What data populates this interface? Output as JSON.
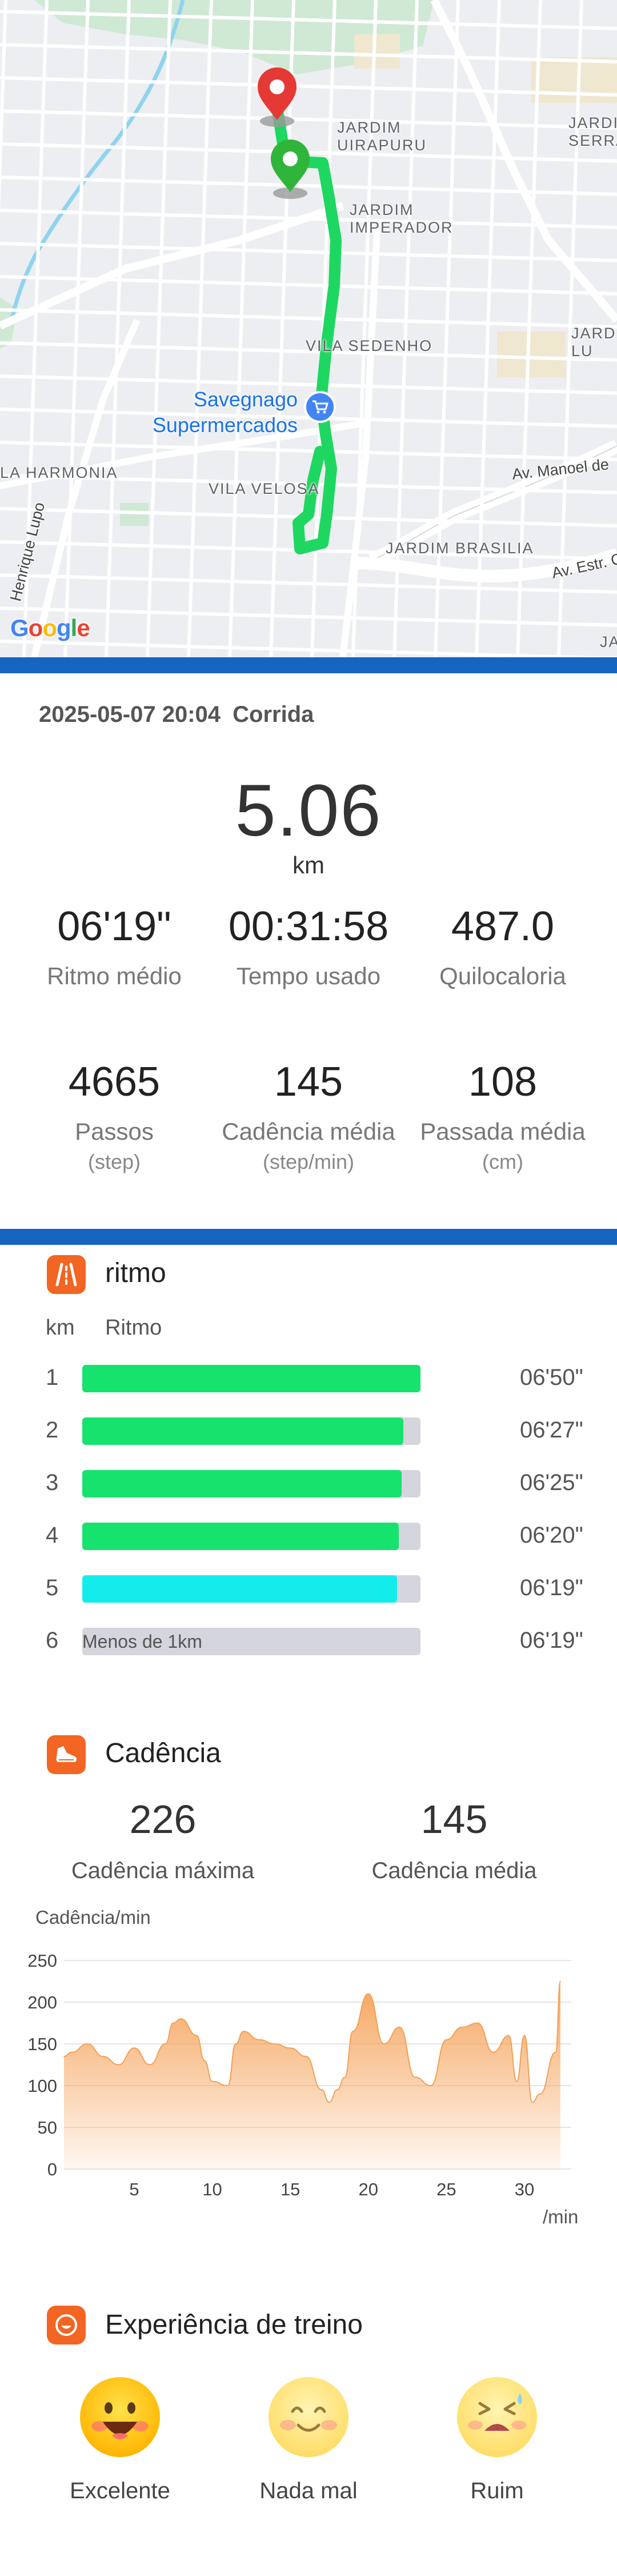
{
  "map": {
    "labels": {
      "jardim_uirapuru": "JARDIM\nUIRAPURU",
      "jardim_serra": "JARDI\nSERRA A",
      "jardim_imperador": "JARDIM\nIMPERADOR",
      "vila_sedenho": "VILA SEDENHO",
      "jard_lu": "JARD\nLU",
      "la_harmonia": "LA HARMONIA",
      "vila_velosa": "VILA VELOSA",
      "jardim_brasilia": "JARDIM BRASILIA",
      "ja": "JA"
    },
    "poi": "Savegnago\nSupermercados",
    "streets": {
      "av_manoel": "Av. Manoel de",
      "av_estr": "Av. Estr. C",
      "henrique_lupo": "Henrique Lupo"
    },
    "logo": "Google",
    "logo_colors": [
      "#4285f4",
      "#ea4335",
      "#fbbc05",
      "#4285f4",
      "#34a853",
      "#ea4335"
    ],
    "route_color": "#1ed760",
    "start_color": "#2fb53a",
    "end_color": "#e53935"
  },
  "activity": {
    "datetime": "2025-05-07 20:04",
    "type": "Corrida",
    "distance": "5.06",
    "distance_unit": "km"
  },
  "stats_row1": [
    {
      "value": "06'19\"",
      "label": "Ritmo médio"
    },
    {
      "value": "00:31:58",
      "label": "Tempo usado"
    },
    {
      "value": "487.0",
      "label": "Quilocaloria"
    }
  ],
  "stats_row2": [
    {
      "value": "4665",
      "label": "Passos",
      "unit": "(step)"
    },
    {
      "value": "145",
      "label": "Cadência média",
      "unit": "(step/min)"
    },
    {
      "value": "108",
      "label": "Passada média",
      "unit": "(cm)"
    }
  ],
  "pace": {
    "title": "ritmo",
    "col_km": "km",
    "col_pace": "Ritmo",
    "colors": {
      "fill": "#16e26e",
      "best": "#14ecec",
      "track": "#d5d5de"
    },
    "rows": [
      {
        "km": "1",
        "fraction": 1.0,
        "time": "06'50\"",
        "best": false,
        "note": ""
      },
      {
        "km": "2",
        "fraction": 0.95,
        "time": "06'27\"",
        "best": false,
        "note": ""
      },
      {
        "km": "3",
        "fraction": 0.945,
        "time": "06'25\"",
        "best": false,
        "note": ""
      },
      {
        "km": "4",
        "fraction": 0.935,
        "time": "06'20\"",
        "best": false,
        "note": ""
      },
      {
        "km": "5",
        "fraction": 0.93,
        "time": "06'19\"",
        "best": true,
        "note": ""
      },
      {
        "km": "6",
        "fraction": 0,
        "time": "06'19\"",
        "best": false,
        "note": "Menos de 1km"
      }
    ]
  },
  "cadence": {
    "title": "Cadência",
    "max_value": "226",
    "max_label": "Cadência máxima",
    "avg_value": "145",
    "avg_label": "Cadência média",
    "y_axis_label": "Cadência/min",
    "x_unit": "/min"
  },
  "chart_data": {
    "type": "area",
    "ylabel": "Cadência/min",
    "xlabel": "/min",
    "ylim": [
      0,
      250
    ],
    "xlim": [
      0.5,
      33
    ],
    "yticks": [
      0,
      50,
      100,
      150,
      200,
      250
    ],
    "xticks": [
      5,
      10,
      15,
      20,
      25,
      30
    ],
    "grid": true,
    "color": "#f5a055",
    "x": [
      0.5,
      1,
      2,
      3,
      4,
      5,
      6,
      7,
      7.5,
      8,
      9,
      9.5,
      10,
      11,
      11.5,
      12,
      13,
      14,
      15,
      16,
      17,
      17.5,
      18,
      18.5,
      19,
      20,
      21,
      22,
      23,
      24,
      25,
      26,
      27,
      28,
      29,
      29.5,
      30,
      30.5,
      31,
      32,
      32.3
    ],
    "values": [
      135,
      140,
      150,
      135,
      125,
      145,
      125,
      150,
      175,
      180,
      160,
      130,
      105,
      100,
      150,
      165,
      155,
      150,
      145,
      135,
      95,
      80,
      95,
      110,
      165,
      210,
      150,
      170,
      110,
      100,
      155,
      170,
      175,
      140,
      160,
      105,
      160,
      80,
      90,
      140,
      225
    ]
  },
  "experience": {
    "title": "Experiência de treino",
    "options": [
      {
        "label": "Excelente"
      },
      {
        "label": "Nada mal"
      },
      {
        "label": "Ruim"
      }
    ]
  }
}
